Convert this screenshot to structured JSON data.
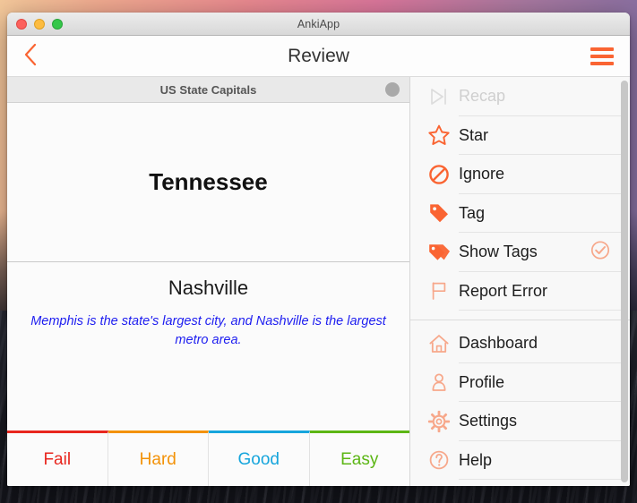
{
  "window": {
    "title": "AnkiApp",
    "traffic_lights": [
      "close-red",
      "minimize-yellow",
      "zoom-green"
    ]
  },
  "appbar": {
    "title": "Review",
    "back_icon": "back-chevron-icon",
    "menu_icon": "hamburger-menu-icon",
    "accent_color": "#FA6432"
  },
  "deck": {
    "title": "US State Capitals",
    "status_dot_color": "#A9A9A9"
  },
  "card": {
    "question": "Tennessee",
    "answer": "Nashville",
    "note": "Memphis is the state's largest city, and Nashville is the largest metro area.",
    "note_color": "#1D1DF0"
  },
  "grades": [
    {
      "label": "Fail",
      "color": "#E8261E"
    },
    {
      "label": "Hard",
      "color": "#F39208"
    },
    {
      "label": "Good",
      "color": "#16A5DC"
    },
    {
      "label": "Easy",
      "color": "#5CB615"
    }
  ],
  "menu": {
    "primary": [
      {
        "label": "Recap",
        "icon": "skip-to-end-icon",
        "disabled": true,
        "checked": false
      },
      {
        "label": "Star",
        "icon": "star-outline-icon",
        "disabled": false,
        "checked": false
      },
      {
        "label": "Ignore",
        "icon": "no-entry-icon",
        "disabled": false,
        "checked": false
      },
      {
        "label": "Tag",
        "icon": "tag-icon",
        "disabled": false,
        "checked": false
      },
      {
        "label": "Show Tags",
        "icon": "double-tag-icon",
        "disabled": false,
        "checked": true
      },
      {
        "label": "Report Error",
        "icon": "flag-icon",
        "disabled": false,
        "checked": false
      }
    ],
    "secondary": [
      {
        "label": "Dashboard",
        "icon": "home-icon",
        "disabled": false,
        "checked": false
      },
      {
        "label": "Profile",
        "icon": "person-icon",
        "disabled": false,
        "checked": false
      },
      {
        "label": "Settings",
        "icon": "gear-icon",
        "disabled": false,
        "checked": false
      },
      {
        "label": "Help",
        "icon": "question-circle-icon",
        "disabled": false,
        "checked": false
      }
    ],
    "check_icon": "check-circle-icon",
    "scrollbar": "menu-scrollbar"
  }
}
